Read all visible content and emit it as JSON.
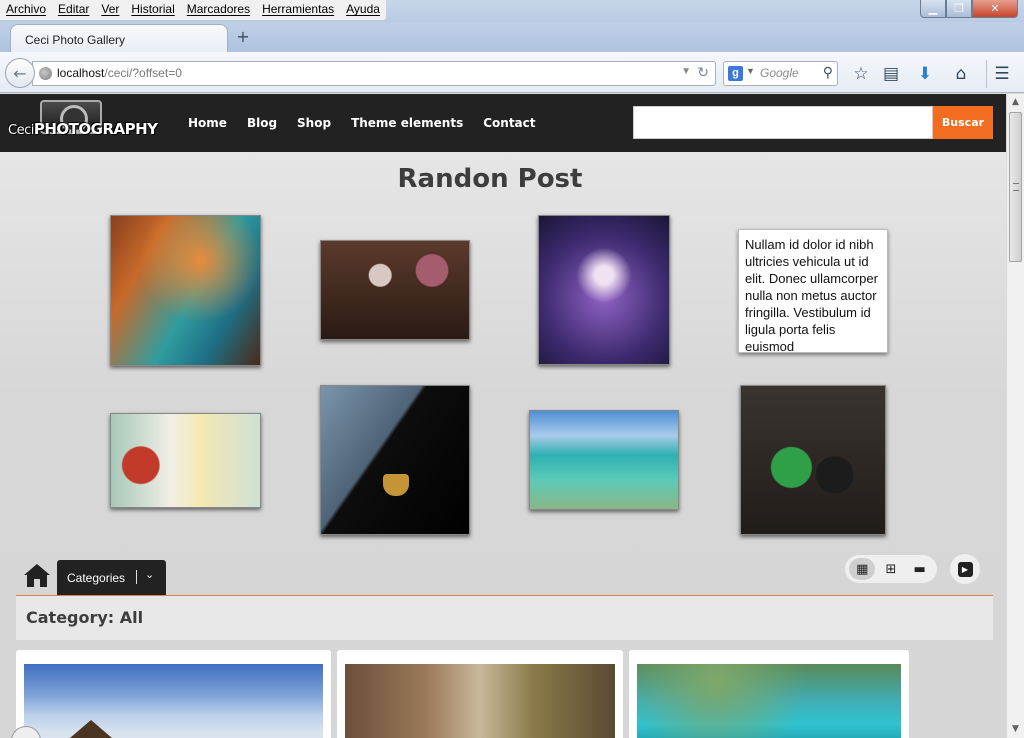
{
  "browser": {
    "menu": [
      "Archivo",
      "Editar",
      "Ver",
      "Historial",
      "Marcadores",
      "Herramientas",
      "Ayuda"
    ],
    "tab_title": "Ceci Photo Gallery",
    "new_tab": "+",
    "url_host": "localhost",
    "url_path": "/ceci/?offset=0",
    "search_placeholder": "Google",
    "window_buttons": {
      "min": "▁",
      "max": "❐",
      "close": "✕"
    }
  },
  "site": {
    "logo_ceci": "Ceci",
    "logo_photography": "PHOTOGRAPHY",
    "nav": [
      "Home",
      "Blog",
      "Shop",
      "Theme elements",
      "Contact"
    ],
    "search_button": "Buscar",
    "search_value": ""
  },
  "random_post": {
    "title": "Randon Post",
    "quote": "Nullam id dolor id nibh ultricies vehicula ut id elit. Donec ullamcorper nulla non metus auctor fringilla. Vestibulum id ligula porta felis euismod"
  },
  "gallery": {
    "categories_button": "Categories",
    "category_heading": "Category: All"
  },
  "icons": {
    "back": "back-arrow-icon",
    "globe": "globe-icon",
    "reload": "reload-icon",
    "search": "magnifier-icon",
    "star": "star-icon",
    "reading_list": "reading-list-icon",
    "download": "download-arrow-icon",
    "home": "home-icon",
    "menu": "hamburger-menu-icon",
    "play": "play-icon",
    "grid_large": "grid-large-icon",
    "grid_small": "grid-small-icon",
    "filmstrip": "filmstrip-icon"
  },
  "colors": {
    "accent": "#f26d20",
    "header": "#222222",
    "divider": "#e37d3f"
  }
}
